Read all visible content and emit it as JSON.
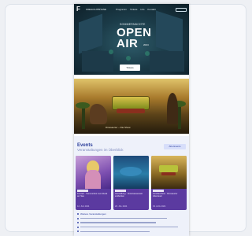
{
  "nav": {
    "logo": "F",
    "brand": "FREILICHTBÜHNE",
    "links": [
      "Programm",
      "Tickets",
      "Info",
      "Kontakt"
    ]
  },
  "hero": {
    "subtitle": "SOMMERNÄCHTE",
    "title_line1": "OPEN",
    "title_line2": "AIR",
    "year": "2024",
    "button": "Tickets"
  },
  "banner": {
    "caption": "Dinosaurier – Die Show"
  },
  "events": {
    "heading": "Events",
    "subheading": "Veranstaltungen im Überblick",
    "all_button": "Alle Events",
    "cards": [
      {
        "text": "Konzert · Sommerfest Live Musik am See",
        "date": "12. JUL 2024"
      },
      {
        "text": "Ausstellung · Unterwasserwelt entdecken",
        "date": "20. JUL 2024"
      },
      {
        "text": "Familienshow · Dinosaurier Abenteuer",
        "date": "03. AUG 2024"
      }
    ],
    "list_heading": "Weitere Veranstaltungen"
  },
  "colors": {
    "accent": "#2c3e9a",
    "card_bg": "#5b3aa0"
  }
}
